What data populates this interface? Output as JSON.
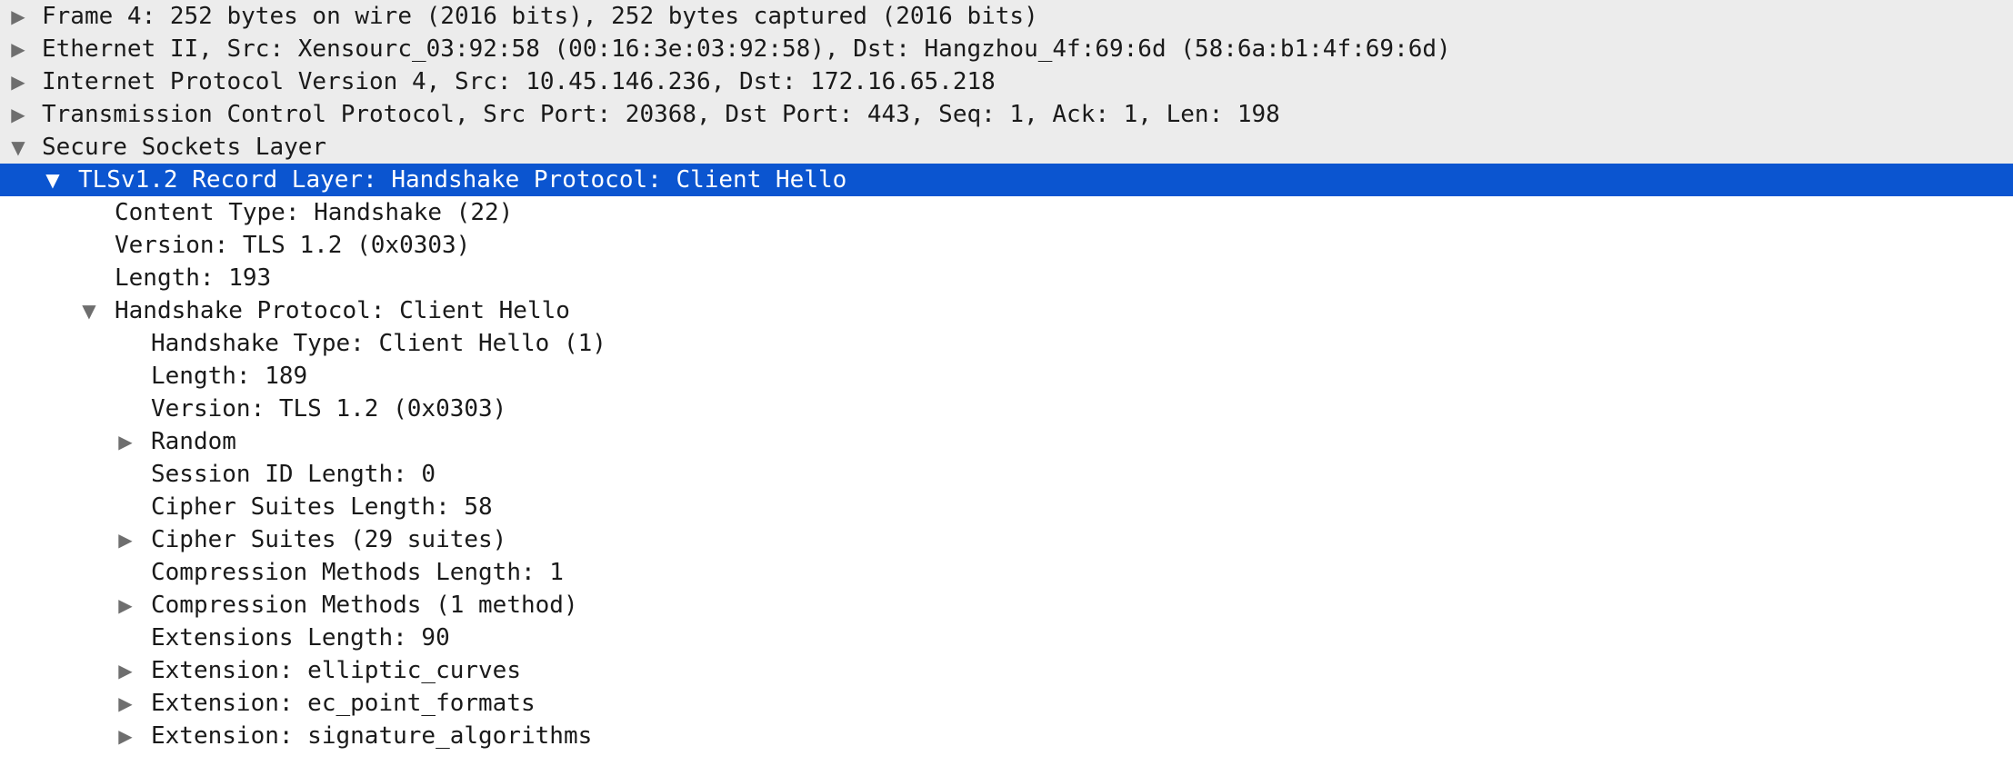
{
  "icons": {
    "collapsed": "▶",
    "expanded": "▼"
  },
  "colors": {
    "selected_bg": "#0b55d0",
    "band_bg": "#ececec",
    "arrow": "#6e6e6e"
  },
  "rows": [
    {
      "label": "Frame 4: 252 bytes on wire (2016 bits), 252 bytes captured (2016 bits)",
      "arrow": "▶"
    },
    {
      "label": "Ethernet II, Src: Xensourc_03:92:58 (00:16:3e:03:92:58), Dst: Hangzhou_4f:69:6d (58:6a:b1:4f:69:6d)",
      "arrow": "▶"
    },
    {
      "label": "Internet Protocol Version 4, Src: 10.45.146.236, Dst: 172.16.65.218",
      "arrow": "▶"
    },
    {
      "label": "Transmission Control Protocol, Src Port: 20368, Dst Port: 443, Seq: 1, Ack: 1, Len: 198",
      "arrow": "▶"
    },
    {
      "label": "Secure Sockets Layer",
      "arrow": "▼"
    },
    {
      "label": "TLSv1.2 Record Layer: Handshake Protocol: Client Hello",
      "arrow": "▼"
    },
    {
      "label": "Content Type: Handshake (22)"
    },
    {
      "label": "Version: TLS 1.2 (0x0303)"
    },
    {
      "label": "Length: 193"
    },
    {
      "label": "Handshake Protocol: Client Hello",
      "arrow": "▼"
    },
    {
      "label": "Handshake Type: Client Hello (1)"
    },
    {
      "label": "Length: 189"
    },
    {
      "label": "Version: TLS 1.2 (0x0303)"
    },
    {
      "label": "Random",
      "arrow": "▶"
    },
    {
      "label": "Session ID Length: 0"
    },
    {
      "label": "Cipher Suites Length: 58"
    },
    {
      "label": "Cipher Suites (29 suites)",
      "arrow": "▶"
    },
    {
      "label": "Compression Methods Length: 1"
    },
    {
      "label": "Compression Methods (1 method)",
      "arrow": "▶"
    },
    {
      "label": "Extensions Length: 90"
    },
    {
      "label": "Extension: elliptic_curves",
      "arrow": "▶"
    },
    {
      "label": "Extension: ec_point_formats",
      "arrow": "▶"
    },
    {
      "label": "Extension: signature_algorithms",
      "arrow": "▶"
    }
  ]
}
